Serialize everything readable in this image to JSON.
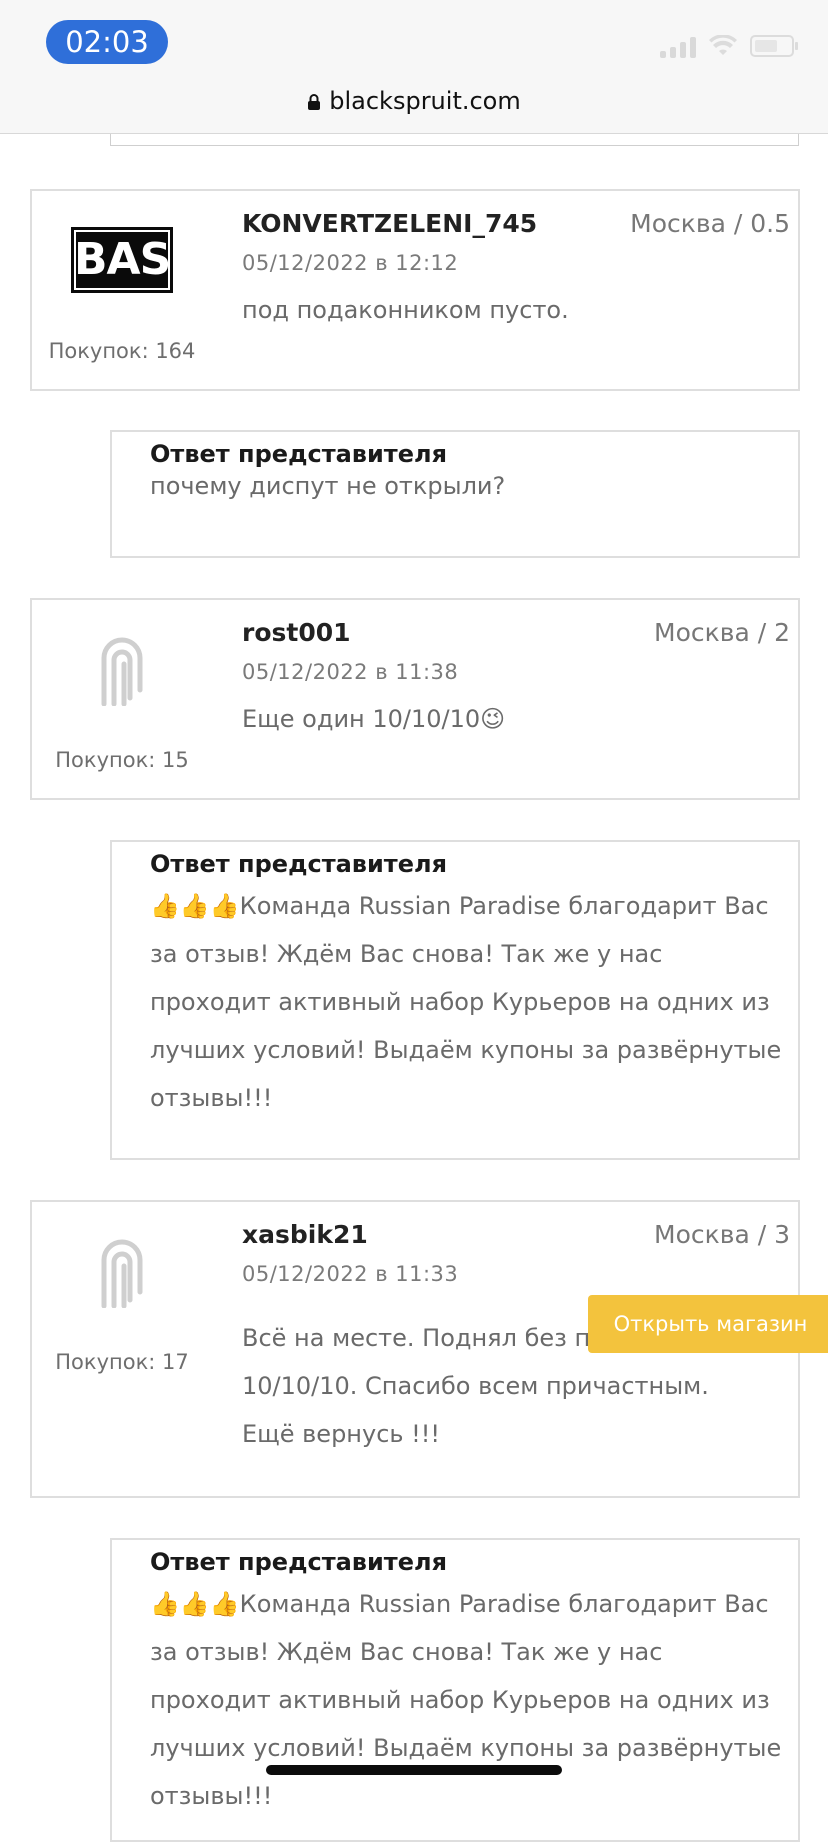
{
  "status": {
    "time": "02:03"
  },
  "browser": {
    "url": "blackspruit.com"
  },
  "reviews": [
    {
      "username": "KONVERTZELENI_745",
      "location": "Москва / 0.5",
      "date": "05/12/2022 в 12:12",
      "text": "под подаконником пусто.",
      "purchases": "Покупок: 164",
      "avatar": "BASE"
    },
    {
      "username": "rost001",
      "location": "Москва / 2",
      "date": "05/12/2022 в 11:38",
      "text": "Еще один 10/10/10😉",
      "purchases": "Покупок: 15",
      "avatar": "default-avatar-icon"
    },
    {
      "username": "xasbik21",
      "location": "Москва / 3",
      "date": "05/12/2022 в 11:33",
      "text": "Всё на месте. Поднял без проблем. 10/10/10. Спасибо всем причастным. Ещё вернусь !!!",
      "purchases": "Покупок: 17",
      "avatar": "default-avatar-icon"
    }
  ],
  "replies": [
    {
      "title": "Ответ представителя",
      "text": "почему диспут не открыли?"
    },
    {
      "title": "Ответ представителя",
      "text": "👍👍👍Команда Russian Paradise благодарит Вас за отзыв! Ждём Вас снова! Так же у нас проходит активный набор Курьеров на одних из лучших условий! Выдаём купоны за развёрнутые отзывы!!!"
    },
    {
      "title": "Ответ представителя",
      "text": "👍👍👍Команда Russian Paradise благодарит Вас за отзыв! Ждём Вас снова! Так же у нас проходит активный набор Курьеров на одних из лучших условий! Выдаём купоны за развёрнутые отзывы!!!"
    }
  ],
  "open_shop_button": "Открыть магазин",
  "colors": {
    "accent": "#f3c33d",
    "time_pill": "#2f6fd9"
  }
}
